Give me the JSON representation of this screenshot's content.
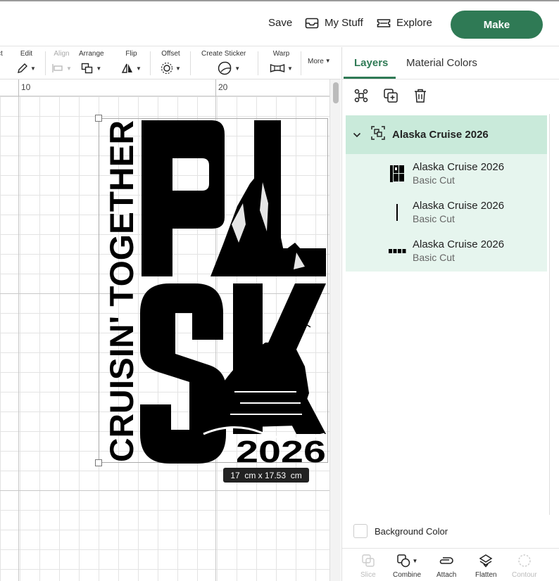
{
  "header": {
    "save_label": "Save",
    "mystuff_label": "My Stuff",
    "explore_label": "Explore",
    "make_label": "Make"
  },
  "toolbar": {
    "select_partial": "ct",
    "edit": "Edit",
    "align": "Align",
    "arrange": "Arrange",
    "flip": "Flip",
    "offset": "Offset",
    "create_sticker": "Create Sticker",
    "warp": "Warp",
    "more": "More"
  },
  "ruler": {
    "labels": [
      "10",
      "20"
    ]
  },
  "design": {
    "side_text": "CRUISIN' TOGETHER",
    "letters_top": "PL",
    "letters_bottom": "SK",
    "year": "2026",
    "size_label": "17  cm x 17.53  cm"
  },
  "colors": {
    "accent": "#2f7a55",
    "group_bg": "#c9eada",
    "layers_bg": "#e6f5ee"
  },
  "panel": {
    "tabs": [
      "Layers",
      "Material Colors"
    ],
    "group_name": "Alaska Cruise 2026",
    "layers": [
      {
        "name": "Alaska Cruise 2026",
        "type": "Basic Cut",
        "icon": "alaska-logo-thumbnail"
      },
      {
        "name": "Alaska Cruise 2026",
        "type": "Basic Cut",
        "icon": "line-thumbnail"
      },
      {
        "name": "Alaska Cruise 2026",
        "type": "Basic Cut",
        "icon": "year-text-thumbnail"
      }
    ],
    "background_color_label": "Background Color",
    "bottom_tools": {
      "slice": "Slice",
      "combine": "Combine",
      "attach": "Attach",
      "flatten": "Flatten",
      "contour": "Contour"
    }
  }
}
